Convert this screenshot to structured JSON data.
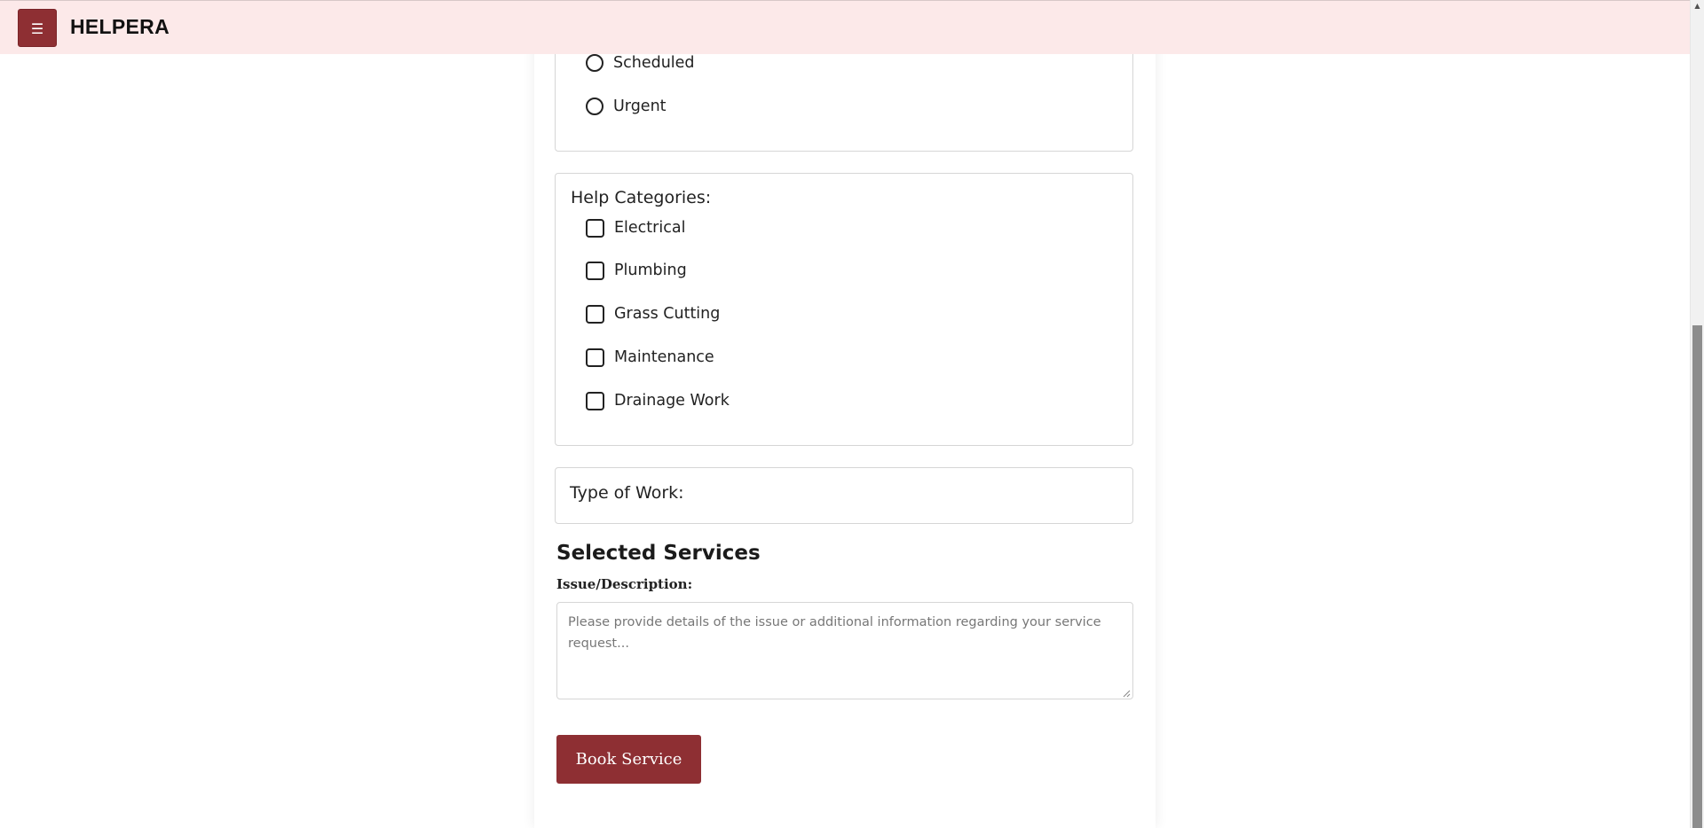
{
  "header": {
    "menu_icon": "☰",
    "brand": "HELPERA"
  },
  "urgency": {
    "options": [
      {
        "label": "Scheduled",
        "checked": false
      },
      {
        "label": "Urgent",
        "checked": false
      }
    ]
  },
  "categories": {
    "legend": "Help Categories:",
    "options": [
      {
        "label": "Electrical",
        "checked": false
      },
      {
        "label": "Plumbing",
        "checked": false
      },
      {
        "label": "Grass Cutting",
        "checked": false
      },
      {
        "label": "Maintenance",
        "checked": false
      },
      {
        "label": "Drainage Work",
        "checked": false
      }
    ]
  },
  "work_type": {
    "legend": "Type of Work:"
  },
  "selected_services": {
    "title": "Selected Services"
  },
  "description": {
    "label": "Issue/Description:",
    "placeholder": "Please provide details of the issue or additional information regarding your service request...",
    "value": ""
  },
  "actions": {
    "book_label": "Book Service"
  },
  "colors": {
    "brand": "#8e2f33",
    "header_bg": "#fce9e9"
  }
}
